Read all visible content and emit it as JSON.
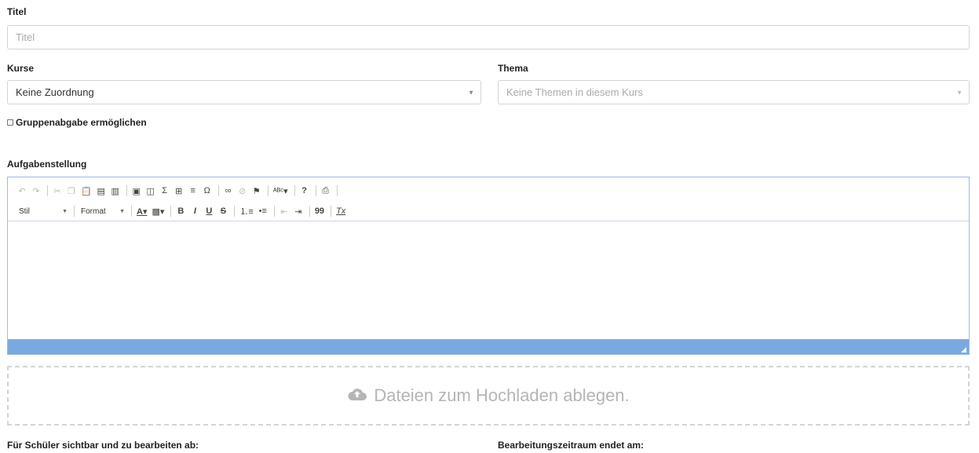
{
  "title_field": {
    "label": "Titel",
    "placeholder": "Titel"
  },
  "courses": {
    "label": "Kurse",
    "selected": "Keine Zuordnung"
  },
  "topic": {
    "label": "Thema",
    "selected": "Keine Themen in diesem Kurs"
  },
  "group_submission": {
    "label": "Gruppenabgabe ermöglichen",
    "checked": false
  },
  "task": {
    "label": "Aufgabenstellung",
    "toolbar": {
      "row1": [
        "undo-icon",
        "redo-icon",
        "|",
        "cut-icon",
        "copy-icon",
        "paste-icon",
        "paste-text-icon",
        "paste-word-icon",
        "|",
        "image-icon",
        "image-plus-icon",
        "sigma-icon",
        "table-icon",
        "horizontal-line-icon",
        "omega-icon",
        "|",
        "link-icon",
        "unlink-icon",
        "anchor-flag-icon",
        "|",
        "spellcheck-icon",
        "|",
        "help-icon",
        "|",
        "print-icon"
      ],
      "style_label": "Stil",
      "format_label": "Format",
      "row2_buttons": {
        "bold": "B",
        "italic": "I",
        "underline": "U",
        "strike": "S",
        "quote": "99",
        "clear": "Tx"
      }
    }
  },
  "dropzone": {
    "text": "Dateien zum Hochladen ablegen."
  },
  "visible_from": {
    "label": "Für Schüler sichtbar und zu bearbeiten ab:"
  },
  "deadline": {
    "label": "Bearbeitungszeitraum endet am:"
  },
  "colors": {
    "accent": "#7aa9e0",
    "border": "#d4d4d4"
  }
}
